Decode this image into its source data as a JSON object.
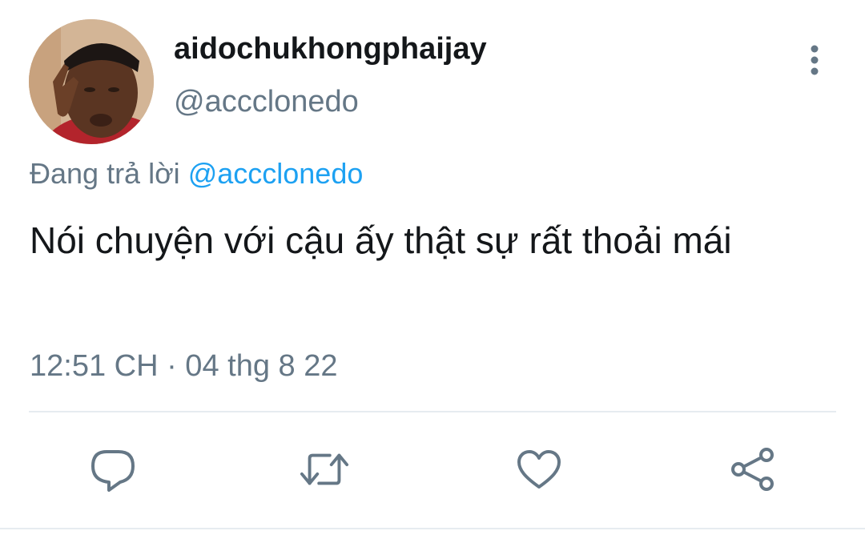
{
  "author": {
    "display_name": "aidochukhongphaijay",
    "handle": "@accclonedo",
    "avatar_icon": "profile-photo"
  },
  "reply": {
    "prefix": "Đang trả lời",
    "mention": "@accclonedo"
  },
  "tweet": {
    "text": "Nói chuyện với cậu ấy thật sự rất thoải mái",
    "timestamp": "12:51 CH · 04 thg 8 22"
  },
  "actions": [
    {
      "name": "reply",
      "icon": "comment-icon"
    },
    {
      "name": "retweet",
      "icon": "retweet-icon"
    },
    {
      "name": "like",
      "icon": "heart-icon"
    },
    {
      "name": "share",
      "icon": "share-icon"
    }
  ],
  "colors": {
    "primary_text": "#14171a",
    "secondary_text": "#657786",
    "mention": "#1da1f2",
    "divider": "#e6ecf0"
  }
}
